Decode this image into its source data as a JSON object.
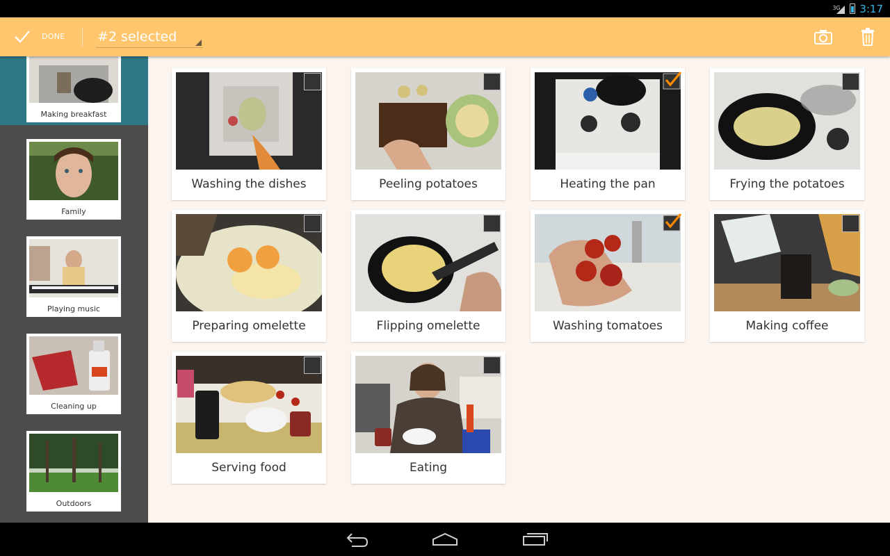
{
  "status": {
    "network": "3G",
    "time": "3:17"
  },
  "action_bar": {
    "done_label": "DONE",
    "selection_label": "#2 selected",
    "icons": [
      "check-icon",
      "camera-icon",
      "trash-icon"
    ]
  },
  "colors": {
    "action_bar": "#ffc66d",
    "sidebar": "#4c4c4c",
    "sidebar_active": "#2f7787",
    "content_bg": "#fcf5ef",
    "check_accent": "#ff8a00"
  },
  "albums": [
    {
      "label": "Making breakfast",
      "active": true
    },
    {
      "label": "Family",
      "active": false
    },
    {
      "label": "Playing music",
      "active": false
    },
    {
      "label": "Cleaning up",
      "active": false
    },
    {
      "label": "Outdoors",
      "active": false
    }
  ],
  "tiles": [
    {
      "label": "Washing the dishes",
      "checked": false
    },
    {
      "label": "Peeling potatoes",
      "checked": false
    },
    {
      "label": "Heating the pan",
      "checked": true
    },
    {
      "label": "Frying the potatoes",
      "checked": false
    },
    {
      "label": "Preparing omelette",
      "checked": false
    },
    {
      "label": "Flipping omelette",
      "checked": false
    },
    {
      "label": "Washing tomatoes",
      "checked": true
    },
    {
      "label": "Making coffee",
      "checked": false
    },
    {
      "label": "Serving food",
      "checked": false
    },
    {
      "label": "Eating",
      "checked": false
    }
  ],
  "nav": {
    "icons": [
      "back-icon",
      "home-icon",
      "recent-apps-icon"
    ]
  }
}
